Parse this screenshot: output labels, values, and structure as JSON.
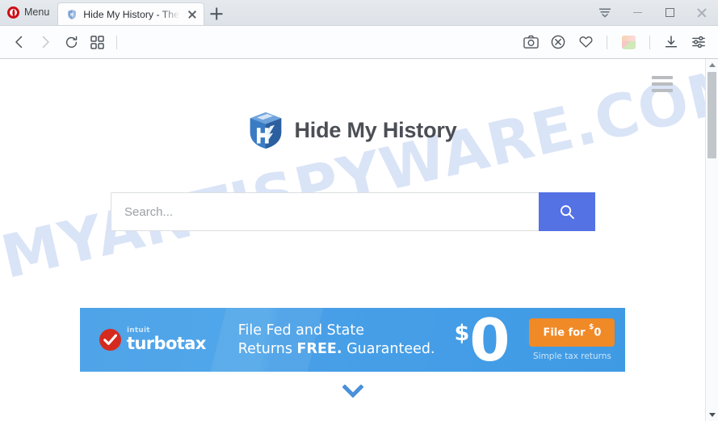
{
  "browser": {
    "name": "Opera",
    "menu_button_label": "Menu",
    "menu_icon": "opera-logo-icon",
    "tabs": [
      {
        "title": "Hide My History - The",
        "favicon": "shield-favicon",
        "active": true,
        "close_icon": "close-icon"
      }
    ],
    "new_tab_icon": "plus-icon",
    "window_controls": [
      {
        "name": "tab-menu-button",
        "icon": "tab-list-chevron-icon"
      },
      {
        "name": "minimize-button",
        "icon": "minimize-icon"
      },
      {
        "name": "maximize-button",
        "icon": "maximize-icon"
      },
      {
        "name": "close-window-button",
        "icon": "close-icon"
      }
    ],
    "toolbar": {
      "left": [
        {
          "name": "back-button",
          "icon": "chevron-left-icon",
          "enabled": true
        },
        {
          "name": "forward-button",
          "icon": "chevron-right-icon",
          "enabled": false
        },
        {
          "name": "reload-button",
          "icon": "reload-icon",
          "enabled": true
        },
        {
          "name": "speed-dial-button",
          "icon": "grid-icon",
          "enabled": true
        }
      ],
      "right": [
        {
          "name": "snapshot-button",
          "icon": "camera-icon"
        },
        {
          "name": "ad-blocker-button",
          "icon": "block-circle-icon"
        },
        {
          "name": "heart-button",
          "icon": "heart-icon"
        },
        {
          "name": "extension-button",
          "icon": "cube-icon"
        },
        {
          "name": "downloads-button",
          "icon": "download-icon"
        },
        {
          "name": "easy-setup-button",
          "icon": "sliders-icon"
        }
      ]
    },
    "scrollbar": {
      "up_arrow_icon": "triangle-up-icon",
      "down_arrow_icon": "triangle-down-icon"
    }
  },
  "page": {
    "watermark": "MYANTISPYWARE.COM",
    "menu_icon": "hamburger-menu-icon",
    "logo": {
      "icon": "hide-my-history-shield-icon",
      "text": "Hide My History"
    },
    "search": {
      "value": "",
      "placeholder": "Search...",
      "button_icon": "search-icon",
      "button_color": "#5472e4"
    },
    "ad_banner": {
      "brand_small": "intuit",
      "brand": "turbotax",
      "brand_icon": "checkmark-circle-icon",
      "headline_line1": "File Fed and State",
      "headline_line2_normal": "Returns ",
      "headline_line2_bold": "FREE.",
      "headline_line2_tail": " Guaranteed.",
      "price_currency": "$",
      "price_amount": "0",
      "cta_label_prefix": "File for ",
      "cta_label_currency": "$",
      "cta_label_amount": "0",
      "cta_note": "Simple tax returns",
      "cta_color": "#f08a27",
      "background_color": "#4fa3e8"
    },
    "scroll_hint_icon": "chevron-down-icon",
    "scroll_hint_color": "#4a90d9"
  }
}
